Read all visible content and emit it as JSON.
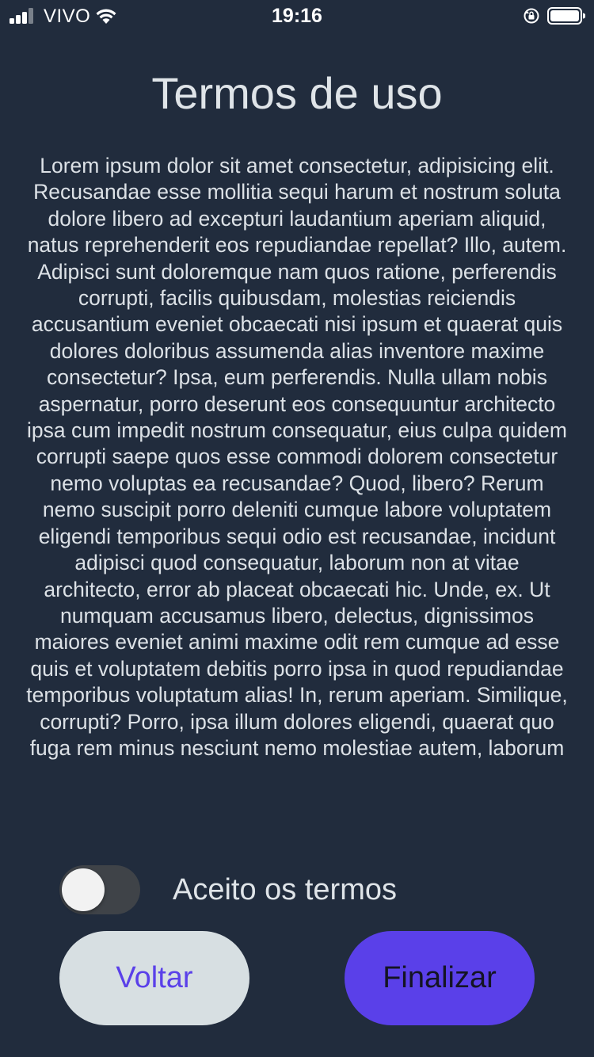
{
  "status_bar": {
    "carrier": "VIVO",
    "time": "19:16",
    "icons": [
      "signal-icon",
      "wifi-icon",
      "rotation-lock-icon",
      "battery-icon"
    ]
  },
  "page": {
    "title": "Termos de uso",
    "terms_text": "Lorem ipsum dolor sit amet consectetur, adipisicing elit. Recusandae esse mollitia sequi harum et nostrum soluta dolore libero ad excepturi laudantium aperiam aliquid, natus reprehenderit eos repudiandae repellat? Illo, autem. Adipisci sunt doloremque nam quos ratione, perferendis corrupti, facilis quibusdam, molestias reiciendis accusantium eveniet obcaecati nisi ipsum et quaerat quis dolores doloribus assumenda alias inventore maxime consectetur? Ipsa, eum perferendis. Nulla ullam nobis aspernatur, porro deserunt eos consequuntur architecto ipsa cum impedit nostrum consequatur, eius culpa quidem corrupti saepe quos esse commodi dolorem consectetur nemo voluptas ea recusandae? Quod, libero? Rerum nemo suscipit porro deleniti cumque labore voluptatem eligendi temporibus sequi odio est recusandae, incidunt adipisci quod consequatur, laborum non at vitae architecto, error ab placeat obcaecati hic. Unde, ex. Ut numquam accusamus libero, delectus, dignissimos maiores eveniet animi maxime odit rem cumque ad esse quis et voluptatem debitis porro ipsa in quod repudiandae temporibus voluptatum alias! In, rerum aperiam. Similique, corrupti? Porro, ipsa illum dolores eligendi, quaerat quo fuga rem minus nesciunt nemo molestiae autem, laborum"
  },
  "accept_toggle": {
    "label": "Aceito os termos",
    "checked": false
  },
  "buttons": {
    "back_label": "Voltar",
    "finish_label": "Finalizar"
  },
  "colors": {
    "background": "#212c3d",
    "accent": "#5a40e9",
    "secondary_button": "#d7dfe2",
    "toggle_track_off": "#3f4348"
  }
}
